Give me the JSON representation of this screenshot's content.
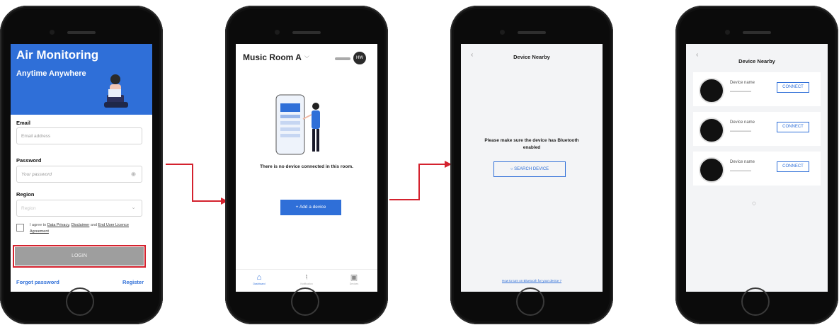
{
  "screen1": {
    "title": "Air Monitoring",
    "subtitle": "Anytime Anywhere",
    "email_label": "Email",
    "email_placeholder": "Email address",
    "password_label": "Password",
    "password_placeholder": "Your password",
    "region_label": "Region",
    "region_placeholder": "Region",
    "agree_prefix": "I agree to",
    "agree_privacy": "Data Privacy",
    "agree_disclaimer": "Disclaimer",
    "agree_and": "and",
    "agree_eula": "End User Licence Agreement",
    "login_label": "LOGIN",
    "forgot_label": "Forgot password",
    "register_label": "Register",
    "accent": "#2f6fd8",
    "highlight": "#d4222e"
  },
  "screen2": {
    "room_name": "Music Room A",
    "avatar_initials": "HW",
    "empty_message": "There is no device connected in this room.",
    "add_button": "+  Add a device",
    "tabs": [
      {
        "label": "Dashboard",
        "icon": "home-icon"
      },
      {
        "label": "Notification",
        "icon": "bell-icon"
      },
      {
        "label": "Devices",
        "icon": "device-icon"
      }
    ]
  },
  "screen3": {
    "header": "Device Nearby",
    "message": "Please make sure the device has Bluetooth enabled",
    "search_button": "SEARCH DEVICE",
    "help_link": "How to turn on Bluetooth for your device ?"
  },
  "screen4": {
    "header": "Device Nearby",
    "devices": [
      {
        "name": "Device name",
        "connect": "CONNECT"
      },
      {
        "name": "Device name",
        "connect": "CONNECT"
      },
      {
        "name": "Device name",
        "connect": "CONNECT"
      }
    ]
  },
  "arrow_color": "#d4222e"
}
